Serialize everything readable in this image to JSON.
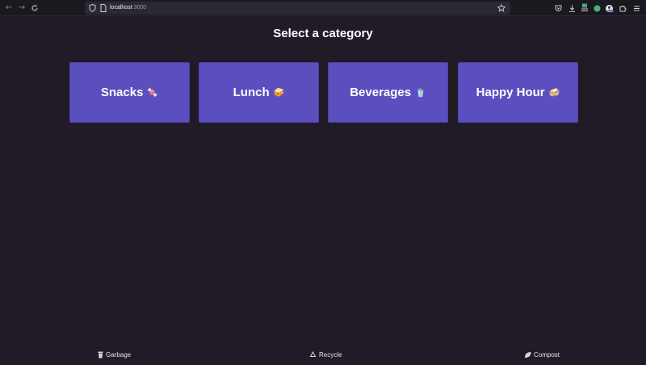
{
  "browser": {
    "url_host": "localhost",
    "url_port": ":3000"
  },
  "page": {
    "title": "Select a category"
  },
  "categories": [
    {
      "label": "Snacks",
      "emoji": "🍬"
    },
    {
      "label": "Lunch",
      "emoji": "🥪"
    },
    {
      "label": "Beverages",
      "emoji": "🥤"
    },
    {
      "label": "Happy Hour",
      "emoji": "🍻"
    }
  ],
  "footer": {
    "garbage": "Garbage",
    "recycle": "Recycle",
    "compost": "Compost"
  },
  "colors": {
    "background": "#201b26",
    "card": "#5b4fc0"
  }
}
